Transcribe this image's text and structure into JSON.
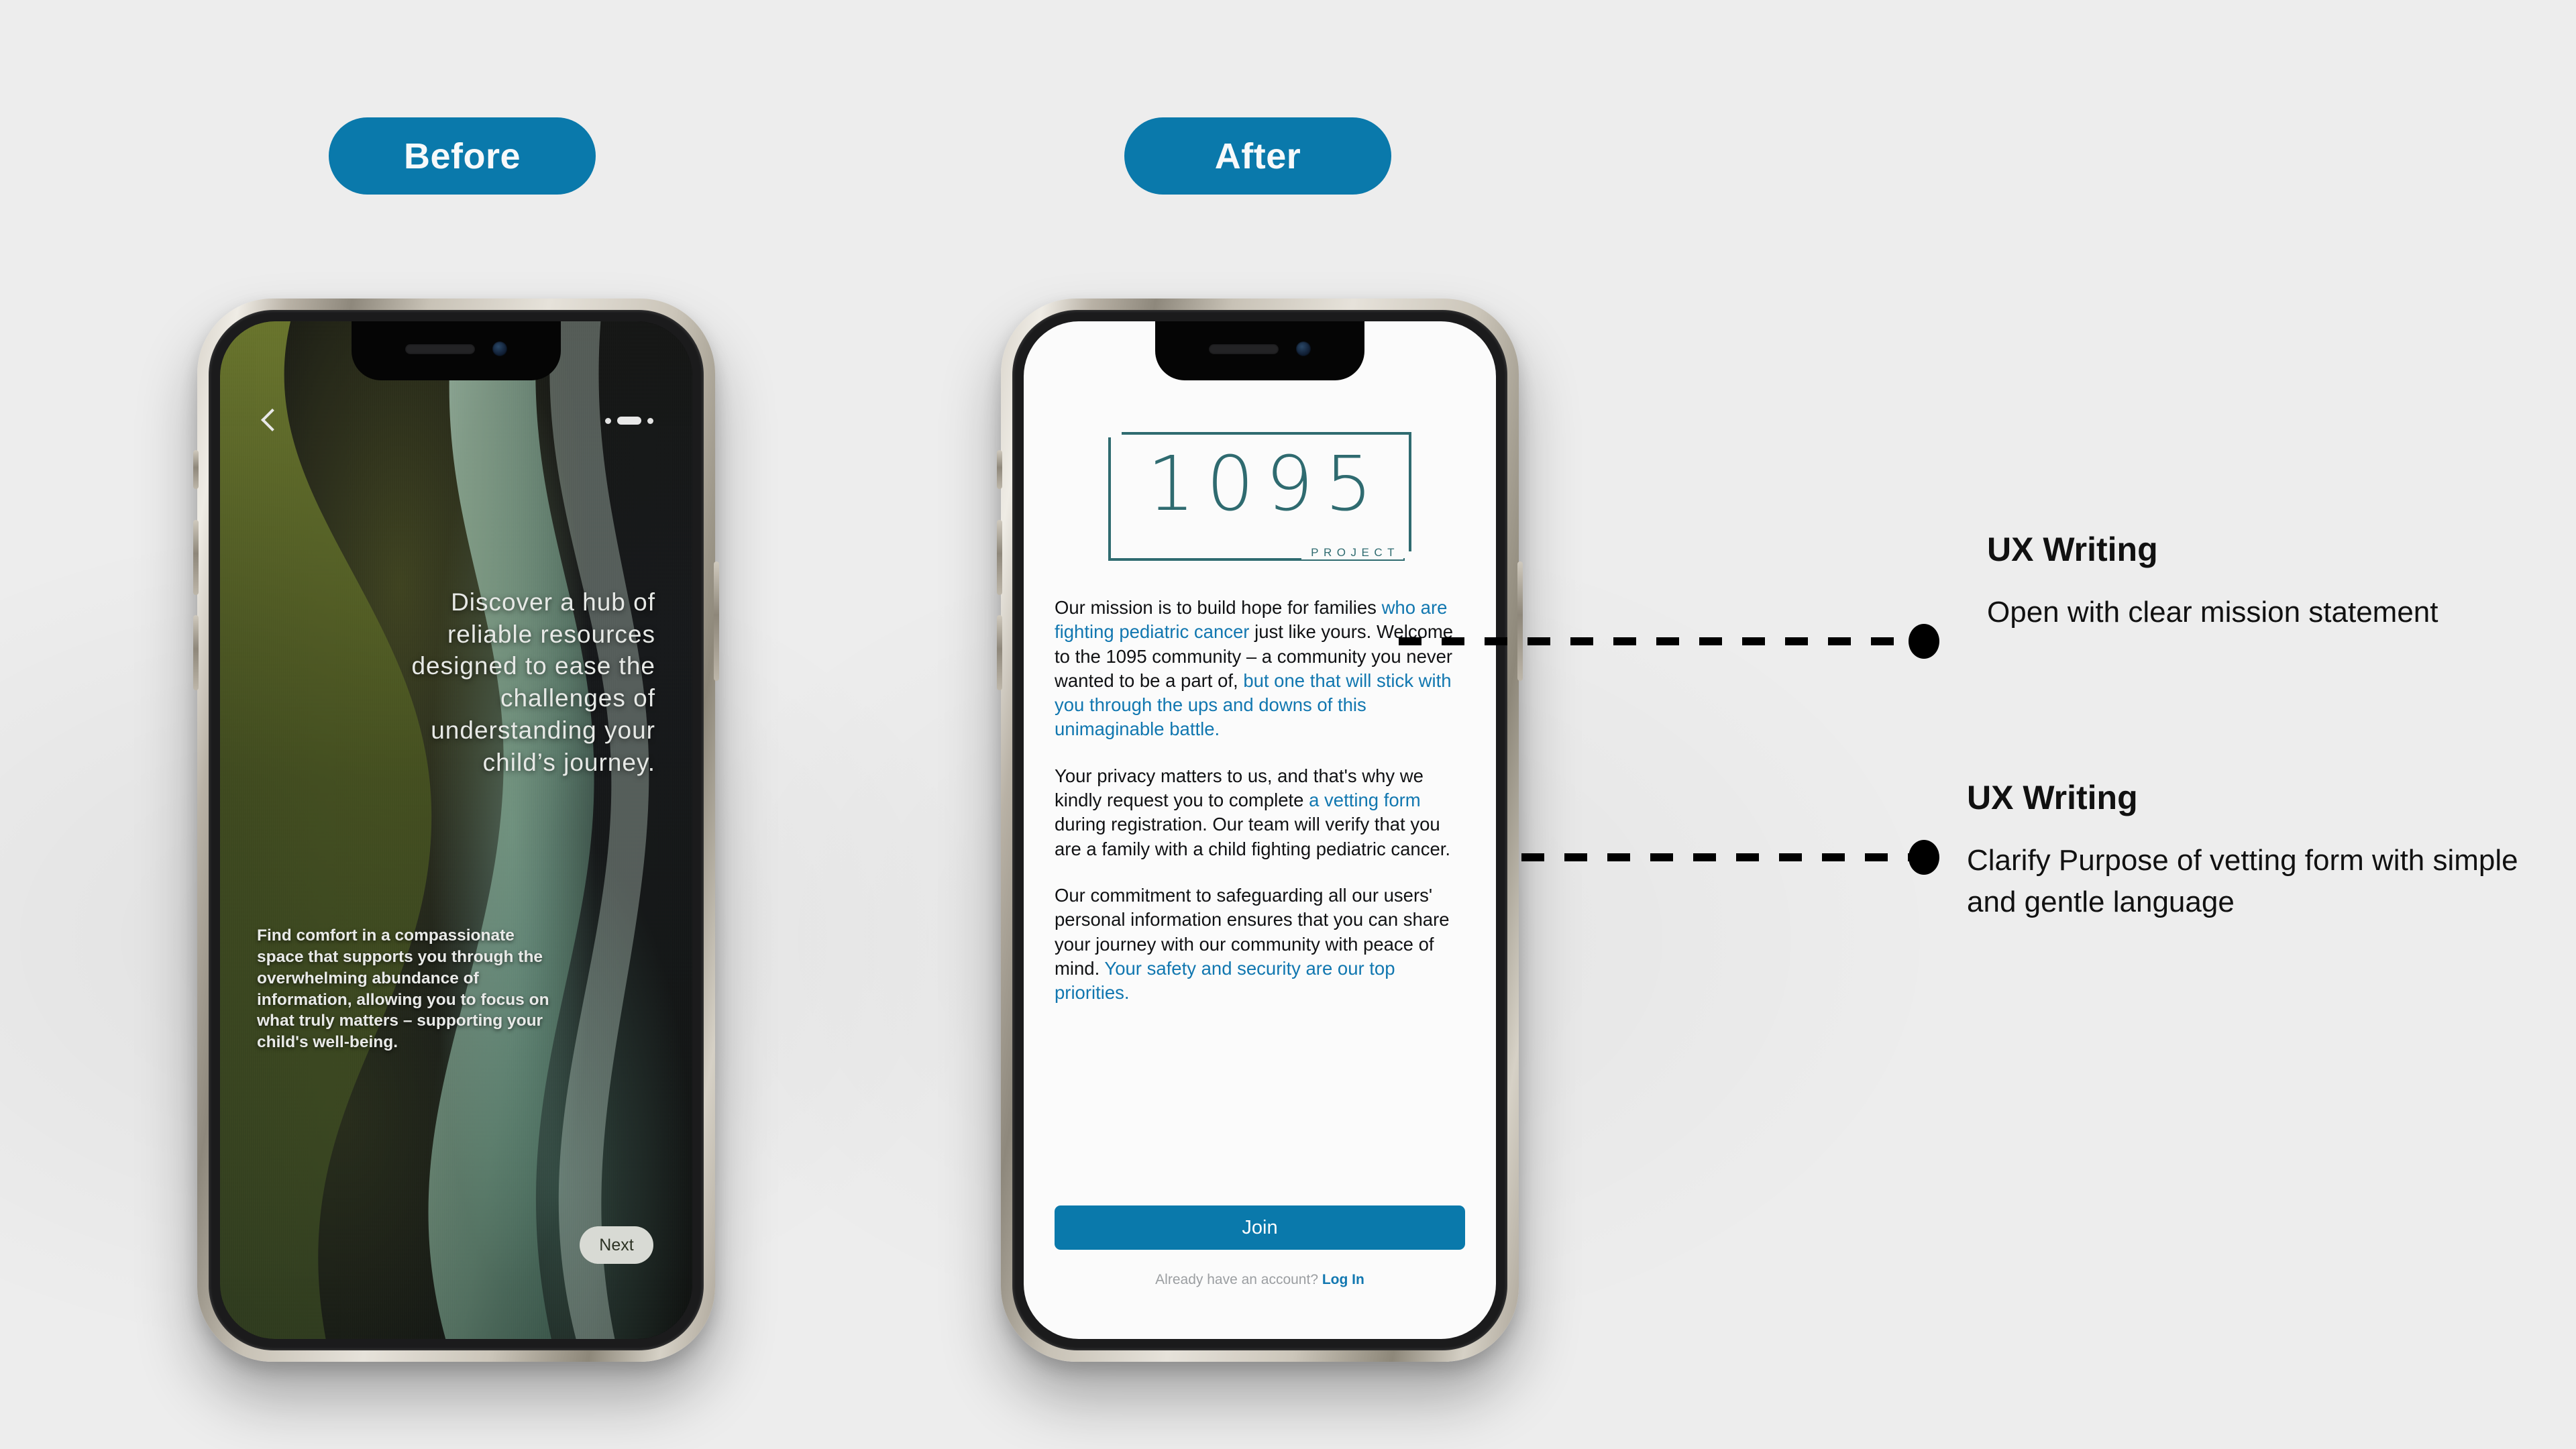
{
  "theme": {
    "background": "#ededed",
    "accent_blue": "#0a79ab",
    "link_blue": "#1177b0",
    "logo_teal": "#2f6b70"
  },
  "labels": {
    "before_pill": "Before",
    "after_pill": "After"
  },
  "before_screen": {
    "back_icon": "chevron-left-icon",
    "page_indicator": {
      "total": 3,
      "active_index": 1
    },
    "headline": "Discover a hub of reliable resources designed to ease the challenges of understanding your child’s journey.",
    "body": "Find comfort in a compassionate space that supports you through the overwhelming abundance of information, allowing you to focus on what truly matters – supporting your child's well-being.",
    "next_label": "Next"
  },
  "after_screen": {
    "logo": {
      "number": "1095",
      "subtitle": "PROJECT"
    },
    "paragraphs": [
      [
        {
          "text": "Our mission is to build hope for families ",
          "highlight": false
        },
        {
          "text": "who are fighting pediatric cancer",
          "highlight": true
        },
        {
          "text": " just like yours. Welcome to the 1095 community – a community you never wanted to be a part of, ",
          "highlight": false
        },
        {
          "text": "but one that will stick with you through the ups and downs of this unimaginable battle.",
          "highlight": true
        }
      ],
      [
        {
          "text": "Your privacy matters to us, and that's why we kindly request you to complete ",
          "highlight": false
        },
        {
          "text": "a vetting form",
          "highlight": true
        },
        {
          "text": " during registration. Our team will verify that you are a family with a child fighting pediatric cancer.",
          "highlight": false
        }
      ],
      [
        {
          "text": "Our commitment to safeguarding all our users' personal information ensures that you can share your journey with our community with peace of mind. ",
          "highlight": false
        },
        {
          "text": "Your safety and security are our top priorities.",
          "highlight": true
        }
      ]
    ],
    "join_label": "Join",
    "footer_prefix": "Already have an account? ",
    "footer_link": "Log In"
  },
  "annotations": [
    {
      "title": "UX Writing",
      "body": "Open with clear mission statement"
    },
    {
      "title": "UX Writing",
      "body": "Clarify Purpose of vetting form with simple and gentle language"
    }
  ]
}
